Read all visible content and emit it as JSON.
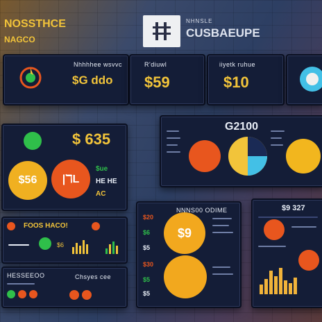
{
  "header": {
    "left_title": "NOSSTHCE",
    "left_sub": "NAGCO",
    "brand_sub": "NHNSLE",
    "brand_title": "CUSBAEUPE"
  },
  "top_cards": [
    {
      "label": "Nhhhhee wsvvc",
      "value": "$G ddo"
    },
    {
      "label": "R'diuwl",
      "value": "$59"
    },
    {
      "label": "iiyetk ruhue",
      "value": "$10"
    }
  ],
  "left_panel": {
    "value": "$ 635",
    "circle_a": "$56",
    "circle_b": "|ℸL",
    "labels": [
      "$ue",
      "HE HE",
      "AC"
    ]
  },
  "right_top_panel": {
    "value": "G2100"
  },
  "mid_left_panel": {
    "title": "FOOS HACO!",
    "legend": [
      "$6",
      "—"
    ]
  },
  "bottom_left_panel": {
    "title": "HESSEEOO",
    "sub": "Chsyes cee"
  },
  "center_panel": {
    "header": "NNNS00 ODIME",
    "circle_value": "$9",
    "labels": [
      "$20",
      "$6",
      "$5",
      "$30",
      "$5",
      "$5"
    ]
  },
  "right_bottom_panel": {
    "value": "$9 327"
  },
  "colors": {
    "panel": "#141d37",
    "gold": "#f2c43a",
    "orange": "#e8561e",
    "cyan": "#43c0e6",
    "green": "#2fbf4a"
  }
}
